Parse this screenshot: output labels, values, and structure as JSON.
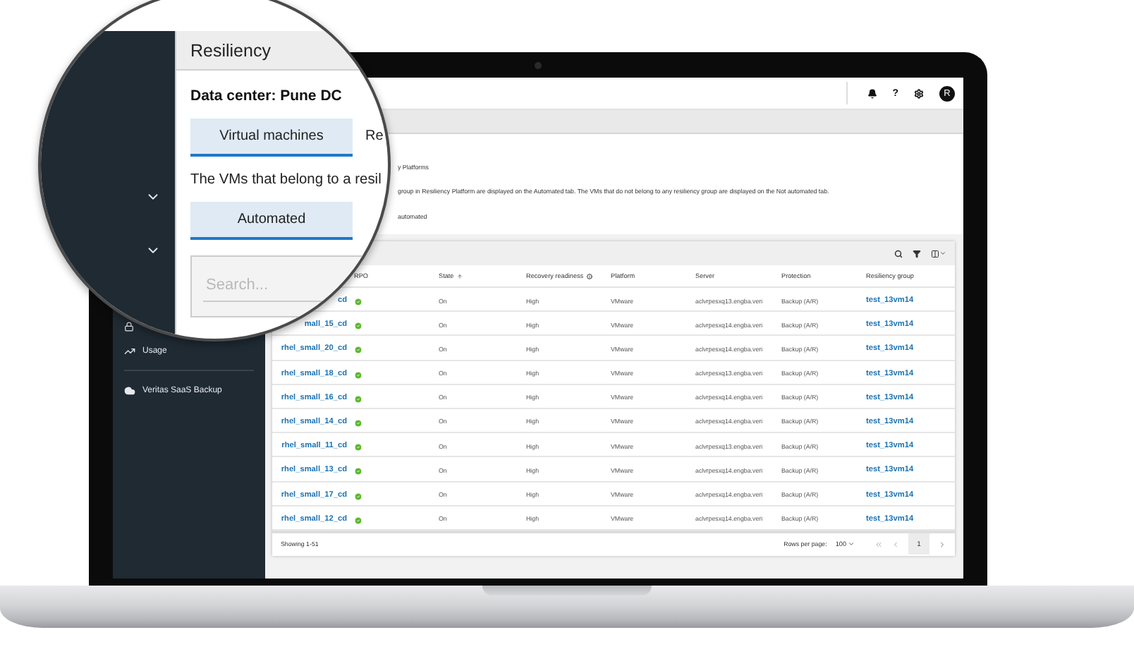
{
  "magnifier": {
    "page_title": "Resiliency",
    "data_center": "Data center: Pune DC",
    "tabs": [
      {
        "label": "Virtual machines",
        "selected": true
      },
      {
        "label": "Re",
        "selected": false
      }
    ],
    "description": "The VMs that belong to a resil",
    "subtabs": [
      {
        "label": "Automated",
        "selected": true
      }
    ],
    "search": {
      "placeholder": "Search..."
    }
  },
  "sidebar": {
    "items": [
      {
        "kind": "lock"
      },
      {
        "kind": "chart",
        "label": "Usage"
      },
      {
        "kind": "divider"
      },
      {
        "kind": "cloud",
        "label": "Veritas SaaS Backup"
      }
    ]
  },
  "topbar": {
    "help": "?",
    "avatar": "R"
  },
  "info": {
    "breadcrumb_fragment": "y Platforms",
    "description": "group in Resiliency Platform are displayed on the Automated tab. The VMs that do not belong to any resiliency group are displayed on the Not automated tab.",
    "tab_fragment": "automated"
  },
  "table": {
    "columns": [
      {
        "label": "RPO"
      },
      {
        "label": "State",
        "sorted": true
      },
      {
        "label": "Recovery readiness",
        "info": true
      },
      {
        "label": "Platform"
      },
      {
        "label": "Server"
      },
      {
        "label": "Protection"
      },
      {
        "label": "Resiliency group"
      }
    ],
    "rows": [
      {
        "name": "cd",
        "rpo_ok": true,
        "state": "On",
        "readiness": "High",
        "platform": "VMware",
        "server": "aclvrpesxq13.engba.veri",
        "protection": "Backup (A/R)",
        "group": "test_13vm14"
      },
      {
        "name": "mall_15_cd",
        "rpo_ok": true,
        "state": "On",
        "readiness": "High",
        "platform": "VMware",
        "server": "aclvrpesxq14.engba.veri",
        "protection": "Backup (A/R)",
        "group": "test_13vm14"
      },
      {
        "name": "rhel_small_20_cd",
        "rpo_ok": true,
        "state": "On",
        "readiness": "High",
        "platform": "VMware",
        "server": "aclvrpesxq14.engba.veri",
        "protection": "Backup (A/R)",
        "group": "test_13vm14"
      },
      {
        "name": "rhel_small_18_cd",
        "rpo_ok": true,
        "state": "On",
        "readiness": "High",
        "platform": "VMware",
        "server": "aclvrpesxq13.engba.veri",
        "protection": "Backup (A/R)",
        "group": "test_13vm14"
      },
      {
        "name": "rhel_small_16_cd",
        "rpo_ok": true,
        "state": "On",
        "readiness": "High",
        "platform": "VMware",
        "server": "aclvrpesxq14.engba.veri",
        "protection": "Backup (A/R)",
        "group": "test_13vm14"
      },
      {
        "name": "rhel_small_14_cd",
        "rpo_ok": true,
        "state": "On",
        "readiness": "High",
        "platform": "VMware",
        "server": "aclvrpesxq14.engba.veri",
        "protection": "Backup (A/R)",
        "group": "test_13vm14"
      },
      {
        "name": "rhel_small_11_cd",
        "rpo_ok": true,
        "state": "On",
        "readiness": "High",
        "platform": "VMware",
        "server": "aclvrpesxq13.engba.veri",
        "protection": "Backup (A/R)",
        "group": "test_13vm14"
      },
      {
        "name": "rhel_small_13_cd",
        "rpo_ok": true,
        "state": "On",
        "readiness": "High",
        "platform": "VMware",
        "server": "aclvrpesxq14.engba.veri",
        "protection": "Backup (A/R)",
        "group": "test_13vm14"
      },
      {
        "name": "rhel_small_17_cd",
        "rpo_ok": true,
        "state": "On",
        "readiness": "High",
        "platform": "VMware",
        "server": "aclvrpesxq14.engba.veri",
        "protection": "Backup (A/R)",
        "group": "test_13vm14"
      },
      {
        "name": "rhel_small_12_cd",
        "rpo_ok": true,
        "state": "On",
        "readiness": "High",
        "platform": "VMware",
        "server": "aclvrpesxq14.engba.veri",
        "protection": "Backup (A/R)",
        "group": "test_13vm14"
      }
    ]
  },
  "footer": {
    "showing": "Showing 1-51",
    "rows_per_page_label": "Rows per page:",
    "rows_per_page": "100",
    "page": "1"
  }
}
